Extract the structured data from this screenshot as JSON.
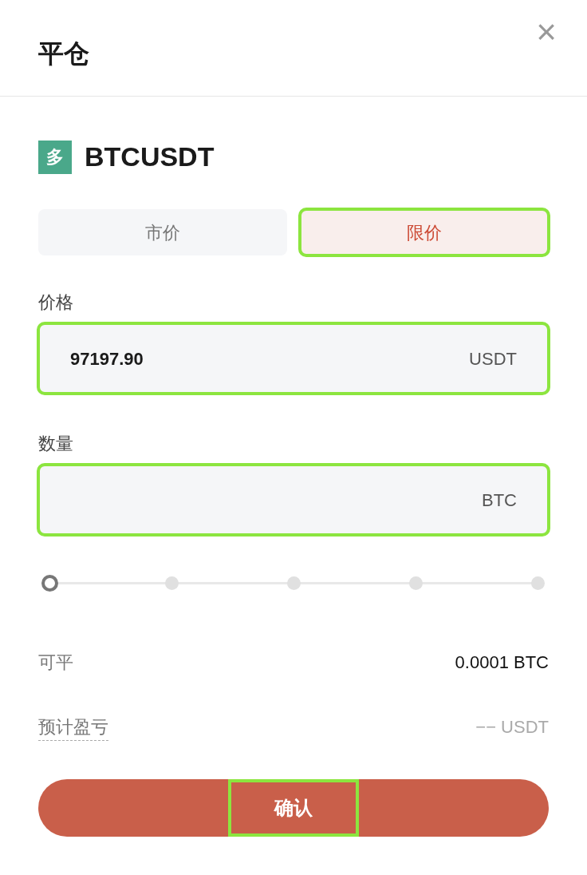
{
  "dialog": {
    "title": "平仓",
    "close": "×"
  },
  "position": {
    "side": "多",
    "symbol": "BTCUSDT"
  },
  "tabs": [
    {
      "label": "市价",
      "selected": false,
      "highlighted": false
    },
    {
      "label": "限价",
      "selected": true,
      "highlighted": true
    }
  ],
  "fields": [
    {
      "label": "价格",
      "value": "97197.90",
      "unit": "USDT",
      "highlighted": true
    },
    {
      "label": "数量",
      "unit": "BTC",
      "highlighted": true
    }
  ],
  "slider": {
    "level": 0
  },
  "info": [
    {
      "label": "可平",
      "value": "0.0001 BTC",
      "kind": "plain"
    },
    {
      "label": "预计盈亏",
      "value": "−− USDT",
      "kind": "hint"
    }
  ],
  "confirm": {
    "label": "确认",
    "highlighted": true
  }
}
